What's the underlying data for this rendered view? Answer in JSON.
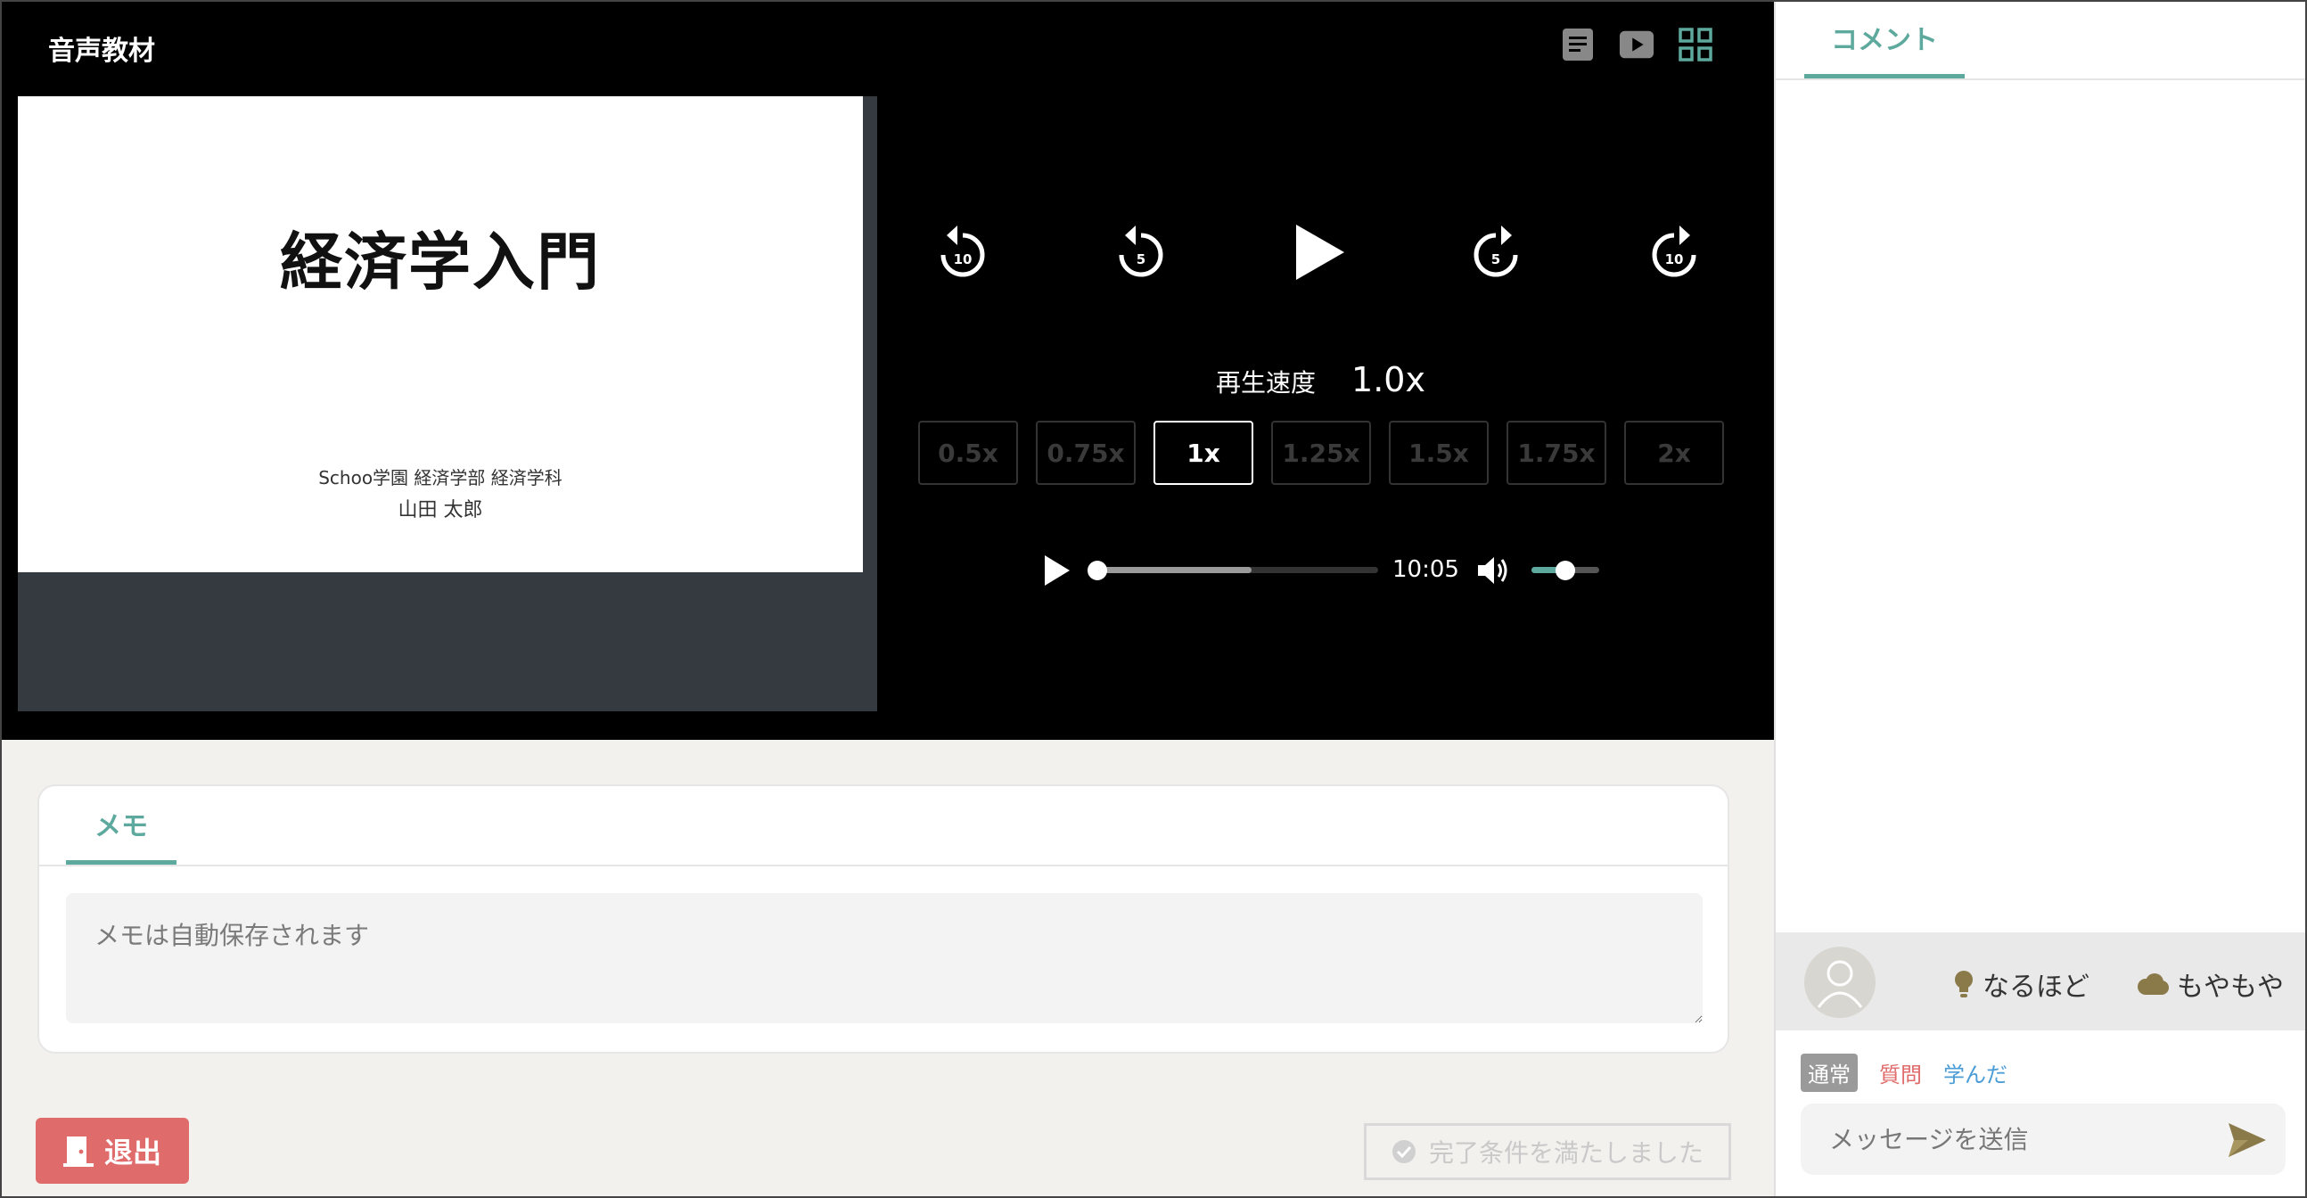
{
  "player": {
    "title": "音声教材",
    "view_icons": [
      "document-icon",
      "video-icon",
      "grid-icon"
    ]
  },
  "slide": {
    "title": "経済学入門",
    "affiliation": "Schoo学園 経済学部 経済学科",
    "author": "山田 太郎"
  },
  "controls": {
    "skip_back_10": "10",
    "skip_back_5": "5",
    "skip_fwd_5": "5",
    "skip_fwd_10": "10"
  },
  "speed": {
    "label": "再生速度",
    "value": "1.0x",
    "options": [
      "0.5x",
      "0.75x",
      "1x",
      "1.25x",
      "1.5x",
      "1.75x",
      "2x"
    ],
    "selected": "1x"
  },
  "audio": {
    "time": "10:05",
    "progress": 0,
    "buffered": 0.55,
    "volume": 0.5
  },
  "memo": {
    "tab_label": "メモ",
    "placeholder": "メモは自動保存されます"
  },
  "exit_label": "退出",
  "complete_label": "完了条件を満たしました",
  "comments": {
    "tab_label": "コメント",
    "reactions": {
      "naruhodo": "なるほど",
      "moyamoya": "もやもや"
    },
    "types": {
      "normal": "通常",
      "question": "質問",
      "learned": "学んだ"
    },
    "message_placeholder": "メッセージを送信"
  },
  "colors": {
    "accent": "#5ea99d",
    "exit": "#e06b6b",
    "question": "#e06b6b",
    "learned": "#4a9cd6"
  }
}
